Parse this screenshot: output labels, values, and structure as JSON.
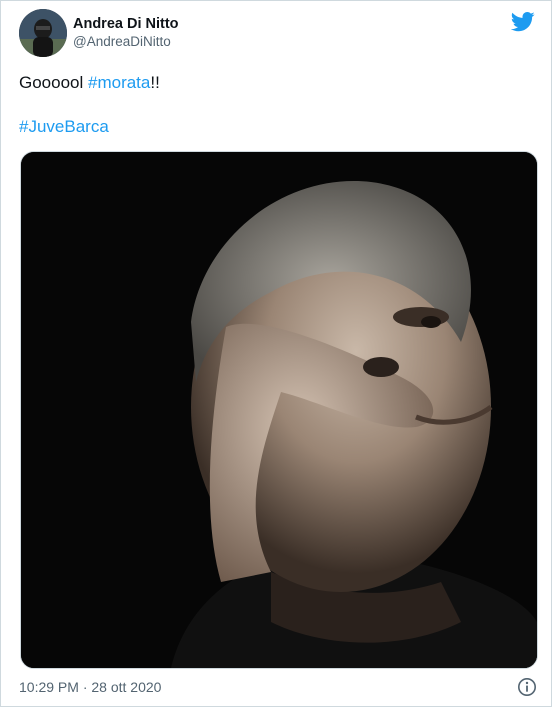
{
  "tweet": {
    "author": {
      "display_name": "Andrea Di Nitto",
      "handle": "@AndreaDiNitto"
    },
    "text": {
      "line1_prefix": "Goooool ",
      "line1_hashtag": "#morata",
      "line1_suffix": "!!",
      "line2_hashtag": "#JuveBarca"
    },
    "timestamp": "10:29 PM · 28 ott 2020",
    "icons": {
      "brand": "twitter-bird-icon",
      "info": "info-icon"
    },
    "colors": {
      "hashtag": "#1d9bf0",
      "brand": "#1d9bf0",
      "text": "#0f1419",
      "muted": "#536471"
    }
  }
}
